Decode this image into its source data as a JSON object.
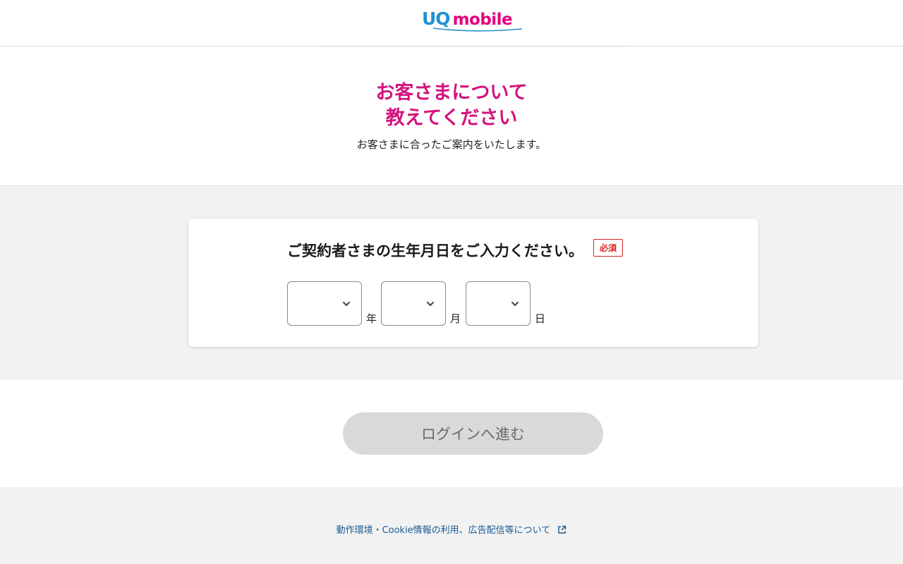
{
  "header": {
    "logo_uq": "UQ",
    "logo_mobile": "mobile",
    "brand_colors": {
      "uq": "#1f92d1",
      "mobile": "#e4007f"
    }
  },
  "intro": {
    "title_line1": "お客さまについて",
    "title_line2": "教えてください",
    "subtitle": "お客さまに合ったご案内をいたします。",
    "title_color": "#d4127e"
  },
  "birthdate_form": {
    "question": "ご契約者さまの生年月日をご入力ください。",
    "required_badge": "必須",
    "year": {
      "value": "",
      "unit": "年"
    },
    "month": {
      "value": "",
      "unit": "月"
    },
    "day": {
      "value": "",
      "unit": "日"
    }
  },
  "actions": {
    "login_label": "ログインへ進む",
    "login_enabled": false
  },
  "footer": {
    "link_label": "動作環境・Cookie情報の利用、広告配信等について",
    "link_icon": "external-link-icon"
  }
}
